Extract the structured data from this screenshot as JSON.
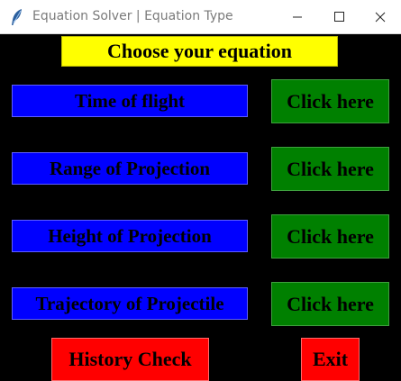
{
  "window": {
    "title": "Equation Solver | Equation Type",
    "controls": [
      "minimize-icon",
      "maximize-icon",
      "close-icon"
    ]
  },
  "header": {
    "text": "Choose your equation"
  },
  "equations": [
    {
      "label": "Time of flight",
      "button": "Click here"
    },
    {
      "label": "Range of Projection",
      "button": "Click here"
    },
    {
      "label": "Height of Projection",
      "button": "Click here"
    },
    {
      "label": "Trajectory of Projectile",
      "button": "Click here"
    }
  ],
  "footer": {
    "history": "History Check",
    "exit": "Exit"
  },
  "colors": {
    "background": "#000000",
    "header": "#ffff00",
    "label": "#0000ff",
    "action": "#008000",
    "footer_buttons": "#ff0000"
  }
}
